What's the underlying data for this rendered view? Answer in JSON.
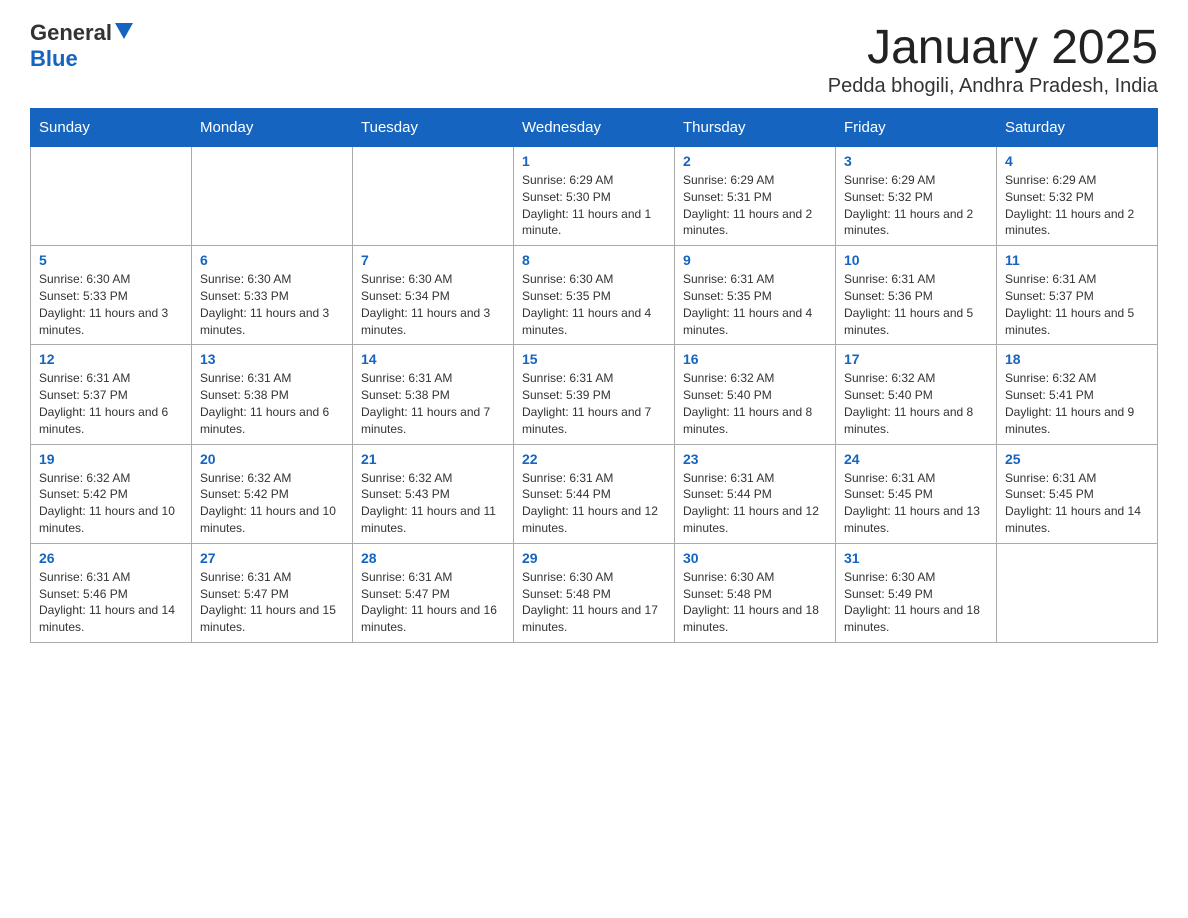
{
  "header": {
    "logo_general": "General",
    "logo_blue": "Blue",
    "title": "January 2025",
    "subtitle": "Pedda bhogili, Andhra Pradesh, India"
  },
  "days_of_week": [
    "Sunday",
    "Monday",
    "Tuesday",
    "Wednesday",
    "Thursday",
    "Friday",
    "Saturday"
  ],
  "weeks": [
    [
      {
        "day": "",
        "info": ""
      },
      {
        "day": "",
        "info": ""
      },
      {
        "day": "",
        "info": ""
      },
      {
        "day": "1",
        "info": "Sunrise: 6:29 AM\nSunset: 5:30 PM\nDaylight: 11 hours and 1 minute."
      },
      {
        "day": "2",
        "info": "Sunrise: 6:29 AM\nSunset: 5:31 PM\nDaylight: 11 hours and 2 minutes."
      },
      {
        "day": "3",
        "info": "Sunrise: 6:29 AM\nSunset: 5:32 PM\nDaylight: 11 hours and 2 minutes."
      },
      {
        "day": "4",
        "info": "Sunrise: 6:29 AM\nSunset: 5:32 PM\nDaylight: 11 hours and 2 minutes."
      }
    ],
    [
      {
        "day": "5",
        "info": "Sunrise: 6:30 AM\nSunset: 5:33 PM\nDaylight: 11 hours and 3 minutes."
      },
      {
        "day": "6",
        "info": "Sunrise: 6:30 AM\nSunset: 5:33 PM\nDaylight: 11 hours and 3 minutes."
      },
      {
        "day": "7",
        "info": "Sunrise: 6:30 AM\nSunset: 5:34 PM\nDaylight: 11 hours and 3 minutes."
      },
      {
        "day": "8",
        "info": "Sunrise: 6:30 AM\nSunset: 5:35 PM\nDaylight: 11 hours and 4 minutes."
      },
      {
        "day": "9",
        "info": "Sunrise: 6:31 AM\nSunset: 5:35 PM\nDaylight: 11 hours and 4 minutes."
      },
      {
        "day": "10",
        "info": "Sunrise: 6:31 AM\nSunset: 5:36 PM\nDaylight: 11 hours and 5 minutes."
      },
      {
        "day": "11",
        "info": "Sunrise: 6:31 AM\nSunset: 5:37 PM\nDaylight: 11 hours and 5 minutes."
      }
    ],
    [
      {
        "day": "12",
        "info": "Sunrise: 6:31 AM\nSunset: 5:37 PM\nDaylight: 11 hours and 6 minutes."
      },
      {
        "day": "13",
        "info": "Sunrise: 6:31 AM\nSunset: 5:38 PM\nDaylight: 11 hours and 6 minutes."
      },
      {
        "day": "14",
        "info": "Sunrise: 6:31 AM\nSunset: 5:38 PM\nDaylight: 11 hours and 7 minutes."
      },
      {
        "day": "15",
        "info": "Sunrise: 6:31 AM\nSunset: 5:39 PM\nDaylight: 11 hours and 7 minutes."
      },
      {
        "day": "16",
        "info": "Sunrise: 6:32 AM\nSunset: 5:40 PM\nDaylight: 11 hours and 8 minutes."
      },
      {
        "day": "17",
        "info": "Sunrise: 6:32 AM\nSunset: 5:40 PM\nDaylight: 11 hours and 8 minutes."
      },
      {
        "day": "18",
        "info": "Sunrise: 6:32 AM\nSunset: 5:41 PM\nDaylight: 11 hours and 9 minutes."
      }
    ],
    [
      {
        "day": "19",
        "info": "Sunrise: 6:32 AM\nSunset: 5:42 PM\nDaylight: 11 hours and 10 minutes."
      },
      {
        "day": "20",
        "info": "Sunrise: 6:32 AM\nSunset: 5:42 PM\nDaylight: 11 hours and 10 minutes."
      },
      {
        "day": "21",
        "info": "Sunrise: 6:32 AM\nSunset: 5:43 PM\nDaylight: 11 hours and 11 minutes."
      },
      {
        "day": "22",
        "info": "Sunrise: 6:31 AM\nSunset: 5:44 PM\nDaylight: 11 hours and 12 minutes."
      },
      {
        "day": "23",
        "info": "Sunrise: 6:31 AM\nSunset: 5:44 PM\nDaylight: 11 hours and 12 minutes."
      },
      {
        "day": "24",
        "info": "Sunrise: 6:31 AM\nSunset: 5:45 PM\nDaylight: 11 hours and 13 minutes."
      },
      {
        "day": "25",
        "info": "Sunrise: 6:31 AM\nSunset: 5:45 PM\nDaylight: 11 hours and 14 minutes."
      }
    ],
    [
      {
        "day": "26",
        "info": "Sunrise: 6:31 AM\nSunset: 5:46 PM\nDaylight: 11 hours and 14 minutes."
      },
      {
        "day": "27",
        "info": "Sunrise: 6:31 AM\nSunset: 5:47 PM\nDaylight: 11 hours and 15 minutes."
      },
      {
        "day": "28",
        "info": "Sunrise: 6:31 AM\nSunset: 5:47 PM\nDaylight: 11 hours and 16 minutes."
      },
      {
        "day": "29",
        "info": "Sunrise: 6:30 AM\nSunset: 5:48 PM\nDaylight: 11 hours and 17 minutes."
      },
      {
        "day": "30",
        "info": "Sunrise: 6:30 AM\nSunset: 5:48 PM\nDaylight: 11 hours and 18 minutes."
      },
      {
        "day": "31",
        "info": "Sunrise: 6:30 AM\nSunset: 5:49 PM\nDaylight: 11 hours and 18 minutes."
      },
      {
        "day": "",
        "info": ""
      }
    ]
  ]
}
